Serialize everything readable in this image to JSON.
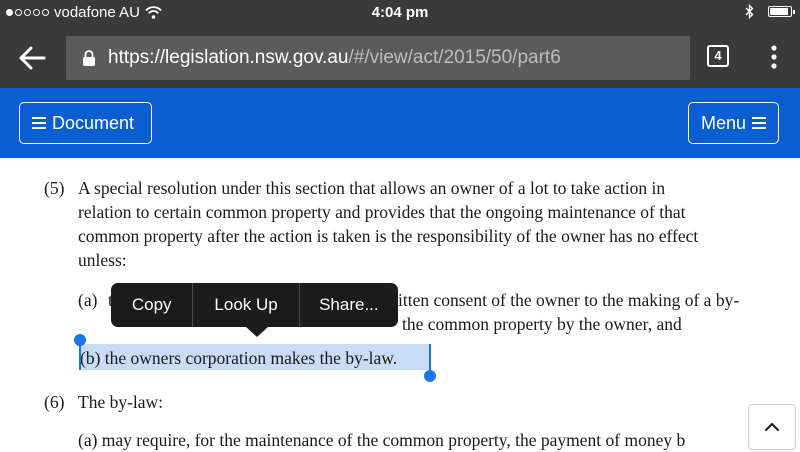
{
  "status_bar": {
    "carrier": "vodafone AU",
    "time": "4:04 pm"
  },
  "browser": {
    "url_scheme": "https://",
    "url_host": "legislation.nsw.gov.au",
    "url_path": "/#/view/act/2015/50/part6",
    "tab_count": "4"
  },
  "site_header": {
    "document_label": "Document",
    "menu_label": "Menu"
  },
  "content": {
    "para5_number": "(5)",
    "para5_lines": [
      "A special resolution under this section that allows an owner of a lot to take action in",
      "relation to certain common property and provides that the ongoing maintenance of that",
      "common property after the action is taken is the responsibility of the owner has no effect",
      "unless:"
    ],
    "item_a_number": "(a)",
    "item_a_start": "t",
    "item_a_line1": "itten consent of the owner to the making of a by-",
    "item_a_line2": "the common property by the owner, and",
    "item_b": "(b)  the owners corporation makes the by-law.",
    "para6_number": "(6)",
    "para6_text": "The by-law:",
    "para6_a": "(a)  may require, for the maintenance of the common property, the payment of money b"
  },
  "context_menu": {
    "copy": "Copy",
    "look_up": "Look Up",
    "share": "Share..."
  },
  "colors": {
    "status_bar": "#3a3a3a",
    "header_blue": "#0b5ed1",
    "selection": "#c9dcf5",
    "selection_handle": "#1877e6"
  },
  "battery_level_percent": 90
}
